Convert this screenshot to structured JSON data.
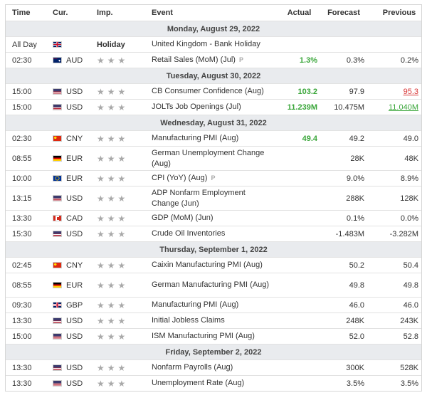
{
  "header": {
    "time": "Time",
    "currency": "Cur.",
    "importance": "Imp.",
    "event": "Event",
    "actual": "Actual",
    "forecast": "Forecast",
    "previous": "Previous"
  },
  "days": [
    {
      "label": "Monday, August 29, 2022",
      "events": [
        {
          "time": "All Day",
          "flag": "gb",
          "currency": "",
          "holiday": "Holiday",
          "event": "United Kingdom - Bank Holiday",
          "actual": "",
          "forecast": "",
          "previous": ""
        },
        {
          "time": "02:30",
          "flag": "au",
          "currency": "AUD",
          "event": "Retail Sales (MoM) (Jul)",
          "prelim": "P",
          "actual": "1.3%",
          "forecast": "0.3%",
          "previous": "0.2%"
        }
      ]
    },
    {
      "label": "Tuesday, August 30, 2022",
      "events": [
        {
          "time": "15:00",
          "flag": "us",
          "currency": "USD",
          "event": "CB Consumer Confidence (Aug)",
          "actual": "103.2",
          "forecast": "97.9",
          "previous": "95.3"
        },
        {
          "time": "15:00",
          "flag": "us",
          "currency": "USD",
          "event": "JOLTs Job Openings (Jul)",
          "actual": "11.239M",
          "forecast": "10.475M",
          "previous": "11.040M"
        }
      ]
    },
    {
      "label": "Wednesday, August 31, 2022",
      "events": [
        {
          "time": "02:30",
          "flag": "cn",
          "currency": "CNY",
          "event": "Manufacturing PMI (Aug)",
          "actual": "49.4",
          "forecast": "49.2",
          "previous": "49.0"
        },
        {
          "time": "08:55",
          "flag": "de",
          "currency": "EUR",
          "event": "German Unemployment Change (Aug)",
          "actual": "",
          "forecast": "28K",
          "previous": "48K"
        },
        {
          "time": "10:00",
          "flag": "eu",
          "currency": "EUR",
          "event": "CPI (YoY) (Aug)",
          "prelim": "P",
          "actual": "",
          "forecast": "9.0%",
          "previous": "8.9%"
        },
        {
          "time": "13:15",
          "flag": "us",
          "currency": "USD",
          "event": "ADP Nonfarm Employment Change (Jun)",
          "actual": "",
          "forecast": "288K",
          "previous": "128K"
        },
        {
          "time": "13:30",
          "flag": "ca",
          "currency": "CAD",
          "event": "GDP (MoM) (Jun)",
          "actual": "",
          "forecast": "0.1%",
          "previous": "0.0%"
        },
        {
          "time": "15:30",
          "flag": "us",
          "currency": "USD",
          "event": "Crude Oil Inventories",
          "actual": "",
          "forecast": "-1.483M",
          "previous": "-3.282M"
        }
      ]
    },
    {
      "label": "Thursday, September 1, 2022",
      "events": [
        {
          "time": "02:45",
          "flag": "cn",
          "currency": "CNY",
          "event": "Caixin Manufacturing PMI (Aug)",
          "actual": "",
          "forecast": "50.2",
          "previous": "50.4"
        },
        {
          "time": "08:55",
          "flag": "de",
          "currency": "EUR",
          "event": "German Manufacturing PMI (Aug)",
          "actual": "",
          "forecast": "49.8",
          "previous": "49.8"
        },
        {
          "time": "09:30",
          "flag": "gb",
          "currency": "GBP",
          "event": "Manufacturing PMI (Aug)",
          "actual": "",
          "forecast": "46.0",
          "previous": "46.0"
        },
        {
          "time": "13:30",
          "flag": "us",
          "currency": "USD",
          "event": "Initial Jobless Claims",
          "actual": "",
          "forecast": "248K",
          "previous": "243K"
        },
        {
          "time": "15:00",
          "flag": "us",
          "currency": "USD",
          "event": "ISM Manufacturing PMI (Aug)",
          "actual": "",
          "forecast": "52.0",
          "previous": "52.8"
        }
      ]
    },
    {
      "label": "Friday, September 2, 2022",
      "events": [
        {
          "time": "13:30",
          "flag": "us",
          "currency": "USD",
          "event": "Nonfarm Payrolls (Aug)",
          "actual": "",
          "forecast": "300K",
          "previous": "528K"
        },
        {
          "time": "13:30",
          "flag": "us",
          "currency": "USD",
          "event": "Unemployment Rate (Aug)",
          "actual": "",
          "forecast": "3.5%",
          "previous": "3.5%"
        }
      ]
    }
  ],
  "colors": {
    "actual_better": "#3aa63a",
    "actual_worse": "#d93636",
    "day_row_bg": "#e9ebee",
    "star": "#a9a9a9"
  },
  "icons": {
    "importance": "star-icon",
    "preliminary": "preliminary-icon"
  }
}
